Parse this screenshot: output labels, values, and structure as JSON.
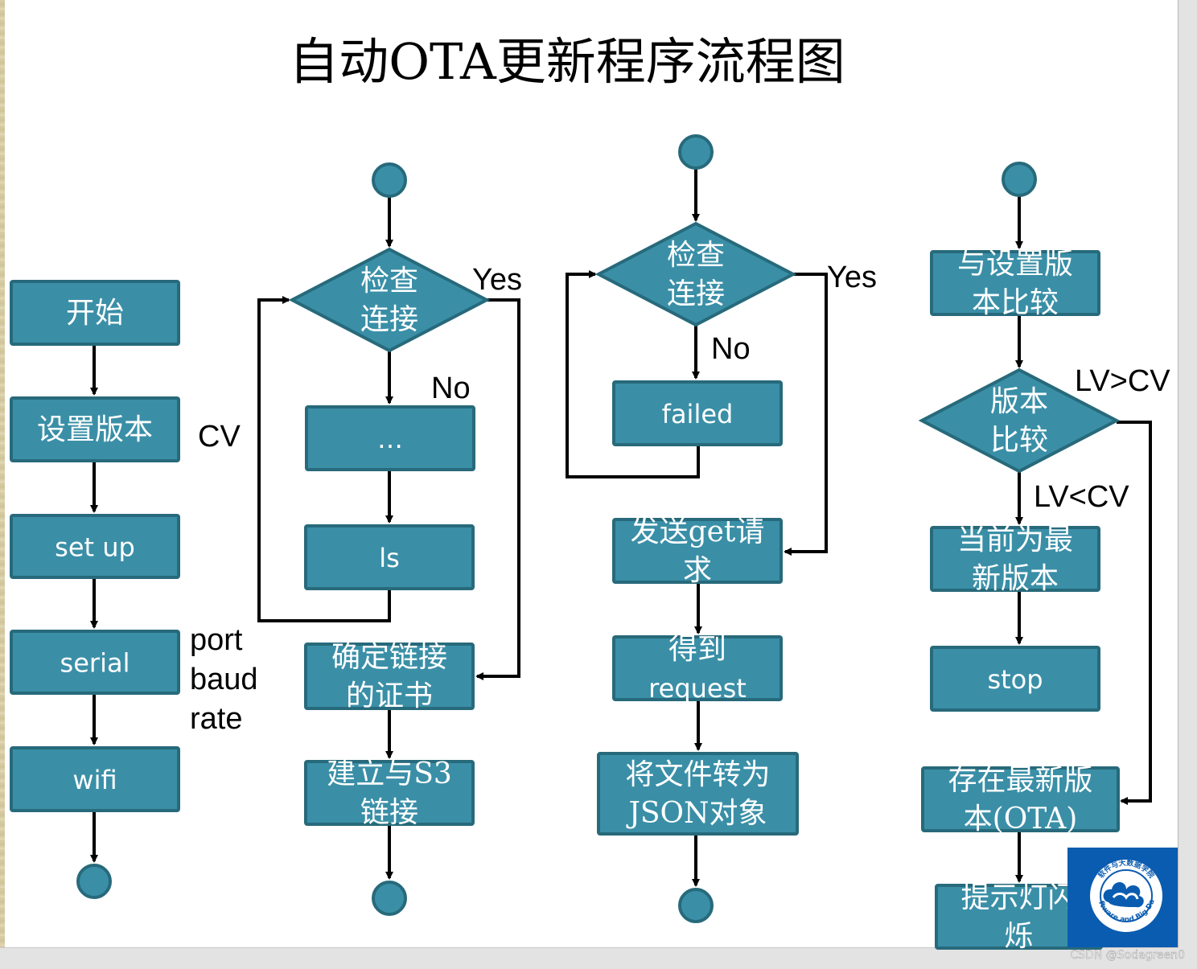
{
  "title": "自动OTA更新程序流程图",
  "colors": {
    "node_fill": "#3a8fa7",
    "node_border": "#276a7b",
    "line": "#000000",
    "logo_bg": "#0a5cb0"
  },
  "columns": [
    {
      "id": "setup",
      "nodes": [
        {
          "id": "start",
          "type": "process",
          "lines": [
            "开始"
          ]
        },
        {
          "id": "set-version",
          "type": "process",
          "lines": [
            "设置版本"
          ]
        },
        {
          "id": "set-up",
          "type": "process",
          "lines": [
            "set up"
          ]
        },
        {
          "id": "serial",
          "type": "process",
          "lines": [
            "serial"
          ]
        },
        {
          "id": "wifi",
          "type": "process",
          "lines": [
            "wifi"
          ]
        },
        {
          "id": "end",
          "type": "terminal",
          "lines": []
        }
      ],
      "annotations": [
        {
          "id": "cv",
          "text": "CV"
        },
        {
          "id": "port",
          "text": "port"
        },
        {
          "id": "baud",
          "text": "baud"
        },
        {
          "id": "rate",
          "text": "rate"
        }
      ]
    },
    {
      "id": "s3-connect",
      "nodes": [
        {
          "id": "start",
          "type": "terminal",
          "lines": []
        },
        {
          "id": "check-connection",
          "type": "decision",
          "lines": [
            "检查",
            "连接"
          ]
        },
        {
          "id": "ellipsis",
          "type": "process",
          "lines": [
            "…"
          ]
        },
        {
          "id": "ls",
          "type": "process",
          "lines": [
            "ls"
          ]
        },
        {
          "id": "determine-cert",
          "type": "process",
          "lines": [
            "确定链接",
            "的证书"
          ]
        },
        {
          "id": "connect-s3",
          "type": "process",
          "lines": [
            "建立与S3",
            "链接"
          ]
        },
        {
          "id": "end",
          "type": "terminal",
          "lines": []
        }
      ],
      "annotations": [
        {
          "id": "yes",
          "text": "Yes"
        },
        {
          "id": "no",
          "text": "No"
        }
      ]
    },
    {
      "id": "http-request",
      "nodes": [
        {
          "id": "start",
          "type": "terminal",
          "lines": []
        },
        {
          "id": "check-connection",
          "type": "decision",
          "lines": [
            "检查",
            "连接"
          ]
        },
        {
          "id": "failed",
          "type": "process",
          "lines": [
            "failed"
          ]
        },
        {
          "id": "send-get",
          "type": "process",
          "lines": [
            "发送get请",
            "求"
          ]
        },
        {
          "id": "get-request",
          "type": "process",
          "lines": [
            "得到",
            "request"
          ]
        },
        {
          "id": "to-json",
          "type": "process",
          "lines": [
            "将文件转为",
            "JSON对象"
          ]
        },
        {
          "id": "end",
          "type": "terminal",
          "lines": []
        }
      ],
      "annotations": [
        {
          "id": "yes",
          "text": "Yes"
        },
        {
          "id": "no",
          "text": "No"
        }
      ]
    },
    {
      "id": "version-check",
      "nodes": [
        {
          "id": "start",
          "type": "terminal",
          "lines": []
        },
        {
          "id": "compare-set-version",
          "type": "process",
          "lines": [
            "与设置版",
            "本比较"
          ]
        },
        {
          "id": "version-compare",
          "type": "decision",
          "lines": [
            "版本",
            "比较"
          ]
        },
        {
          "id": "is-latest",
          "type": "process",
          "lines": [
            "当前为最",
            "新版本"
          ]
        },
        {
          "id": "stop",
          "type": "process",
          "lines": [
            "stop"
          ]
        },
        {
          "id": "newer-exists",
          "type": "process",
          "lines": [
            "存在最新版",
            "本(OTA)"
          ]
        },
        {
          "id": "blink-led",
          "type": "process",
          "lines": [
            "提示灯闪",
            "烁"
          ]
        }
      ],
      "annotations": [
        {
          "id": "lv-gt-cv",
          "text": "LV>CV"
        },
        {
          "id": "lv-lt-cv",
          "text": "LV<CV"
        }
      ]
    }
  ],
  "logo": {
    "top_text": "软件与大数据学院",
    "bottom_text": "Software and Big Data"
  },
  "watermark": "CSDN @Sodagreen0"
}
